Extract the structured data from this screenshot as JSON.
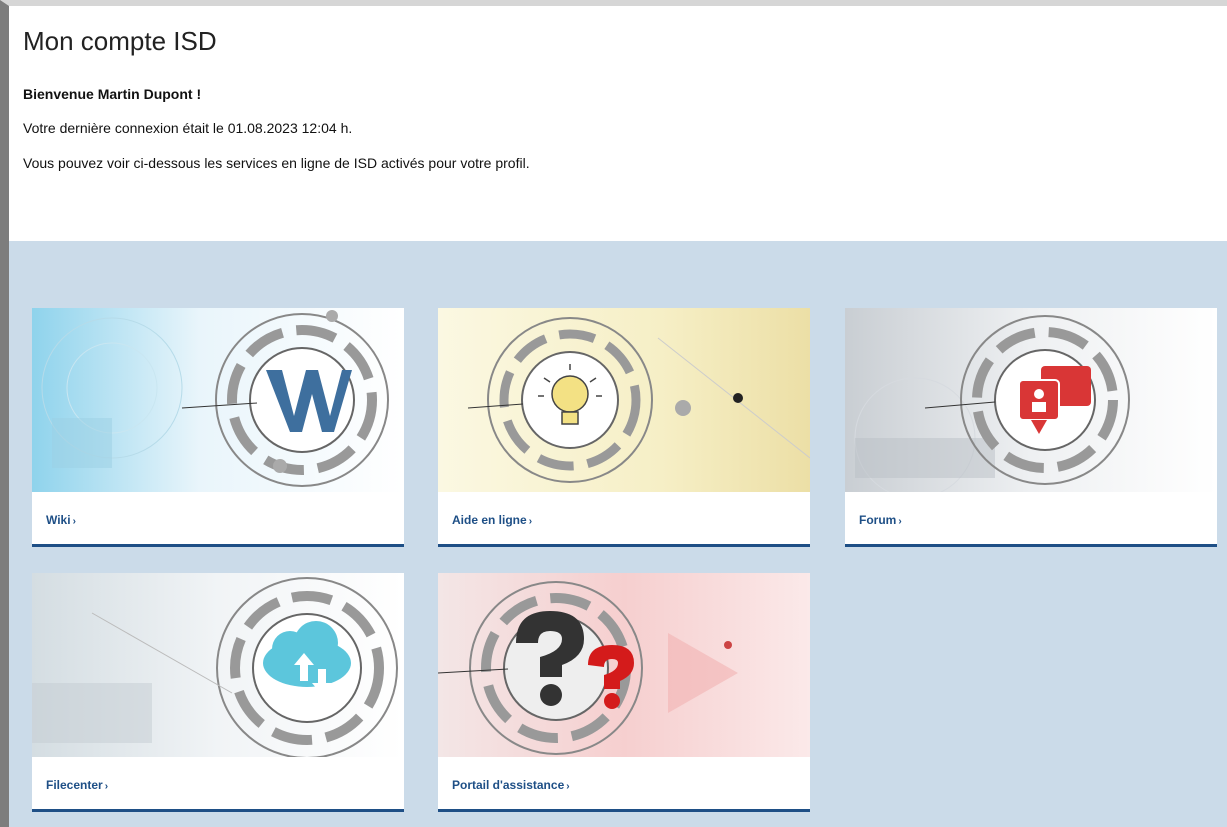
{
  "header": {
    "title": "Mon compte ISD"
  },
  "welcome": "Bienvenue Martin Dupont !",
  "last_login": "Votre dernière connexion était le 01.08.2023 12:04 h.",
  "info": "Vous pouvez voir ci-dessous les services en ligne de ISD activés pour votre profil.",
  "services": [
    {
      "label": "Wiki",
      "icon": "wiki-w-icon"
    },
    {
      "label": "Aide en ligne",
      "icon": "lightbulb-icon"
    },
    {
      "label": "Forum",
      "icon": "chat-bubbles-icon"
    },
    {
      "label": "Filecenter",
      "icon": "cloud-upload-download-icon"
    },
    {
      "label": "Portail d'assistance",
      "icon": "question-marks-icon"
    }
  ],
  "chevron": "›",
  "colors": {
    "link": "#1e4f86",
    "panel": "#cbdbe9"
  }
}
